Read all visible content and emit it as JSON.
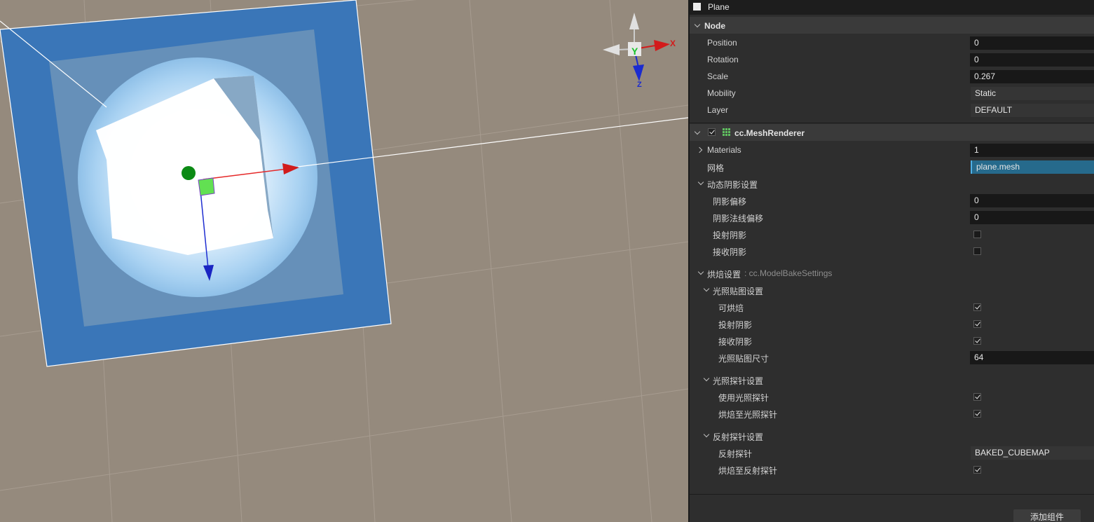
{
  "gizmo": {
    "x_label": "X",
    "y_label": "Y",
    "z_label": "Z"
  },
  "node_bar": {
    "checked": true,
    "name": "Plane"
  },
  "node_section": {
    "title": "Node",
    "props": {
      "position": {
        "label": "Position",
        "value": "0"
      },
      "rotation": {
        "label": "Rotation",
        "value": "0"
      },
      "scale": {
        "label": "Scale",
        "value": "0.267"
      },
      "mobility": {
        "label": "Mobility",
        "value": "Static"
      },
      "layer": {
        "label": "Layer",
        "value": "DEFAULT"
      }
    }
  },
  "mesh_renderer": {
    "title": "cc.MeshRenderer",
    "enabled": true,
    "materials": {
      "label": "Materials",
      "value": "1"
    },
    "mesh": {
      "label": "网格",
      "value": "plane.mesh"
    },
    "dynamic_shadow": {
      "title": "动态阴影设置",
      "shadow_bias": {
        "label": "阴影偏移",
        "value": "0"
      },
      "shadow_normal_bias": {
        "label": "阴影法线偏移",
        "value": "0"
      },
      "cast_shadow": {
        "label": "投射阴影",
        "checked": false
      },
      "receive_shadow": {
        "label": "接收阴影",
        "checked": false
      }
    },
    "bake": {
      "title": "烘焙设置",
      "subtitle": ": cc.ModelBakeSettings",
      "lightmap": {
        "title": "光照贴图设置",
        "bakeable": {
          "label": "可烘焙",
          "checked": true
        },
        "cast_shadow": {
          "label": "投射阴影",
          "checked": true
        },
        "receive_shadow": {
          "label": "接收阴影",
          "checked": true
        },
        "lightmap_size": {
          "label": "光照贴图尺寸",
          "value": "64"
        }
      },
      "light_probe": {
        "title": "光照探针设置",
        "use_probe": {
          "label": "使用光照探针",
          "checked": true
        },
        "bake_to_probe": {
          "label": "烘焙至光照探针",
          "checked": true
        }
      },
      "reflection_probe": {
        "title": "反射探针设置",
        "probe": {
          "label": "反射探针",
          "value": "BAKED_CUBEMAP"
        },
        "bake_to_reflection": {
          "label": "烘焙至反射探针",
          "checked": true
        }
      }
    }
  },
  "add_component_label": "添加组件",
  "colors": {
    "scene_bg": "#958a7d",
    "selection_blue": "#3a76b8",
    "accent": "#4fb0e6"
  }
}
